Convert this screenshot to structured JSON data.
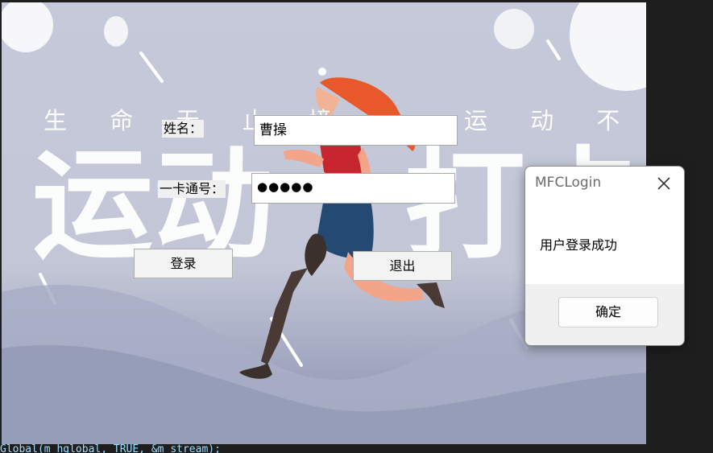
{
  "background": {
    "slogan_left": "生 命 无 止 境",
    "slogan_right": "运 动 不 停",
    "big_left": "运动",
    "big_right": "打卡"
  },
  "login_form": {
    "name_label": "姓名：",
    "name_value": "曹操",
    "card_label": "一卡通号：",
    "card_value": "●●●●●",
    "login_button": "登录",
    "exit_button": "退出"
  },
  "dialog": {
    "title": "MFCLogin",
    "message": "用户登录成功",
    "ok_button": "确定"
  },
  "editor": {
    "code_line": "Global(m_hglobal, TRUE, &m_stream);"
  },
  "colors": {
    "background_top": "#c5c9d9",
    "background_bottom": "#8e94b0",
    "dialog_footer": "#f0f0f0",
    "editor_background": "#1e1e1e"
  },
  "icons": [
    "close-icon"
  ]
}
